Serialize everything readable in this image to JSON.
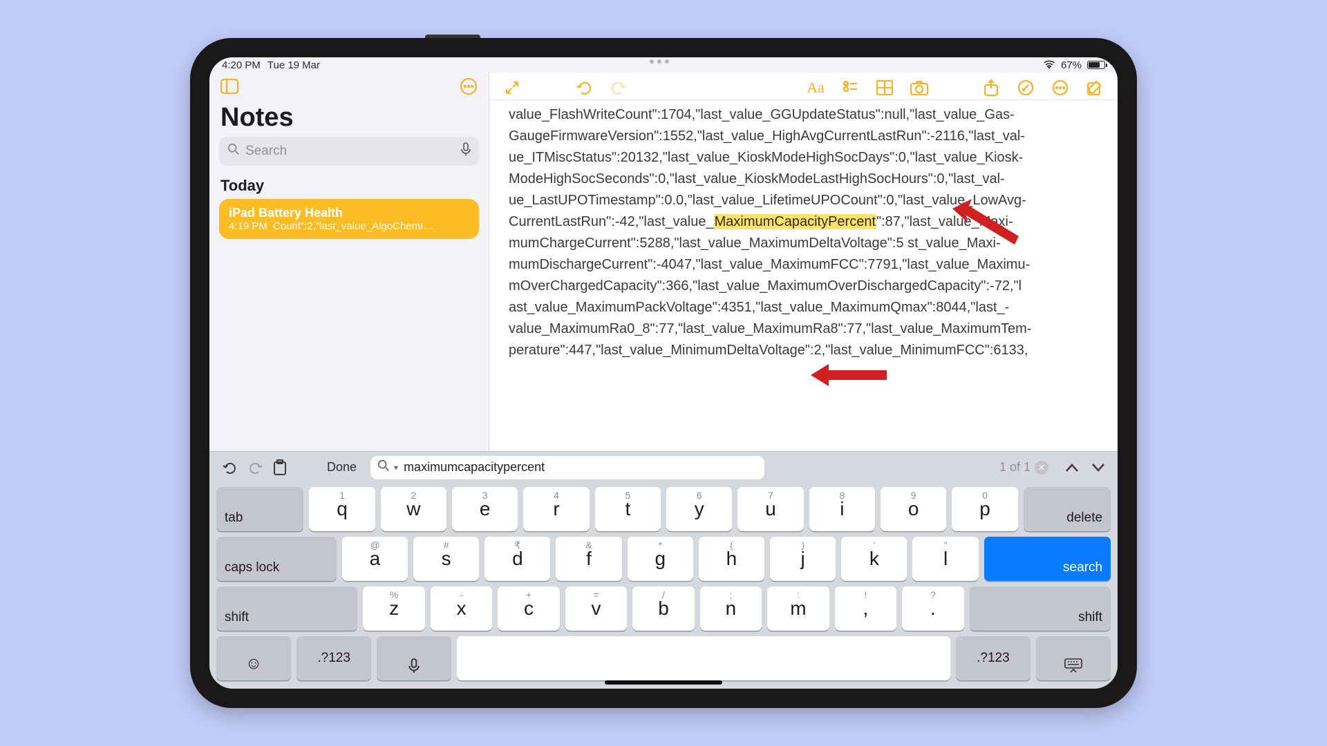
{
  "status": {
    "time": "4:20 PM",
    "date": "Tue 19 Mar",
    "battery_pct": "67%"
  },
  "sidebar": {
    "title": "Notes",
    "search_placeholder": "Search",
    "section": "Today",
    "note": {
      "title": "iPad Battery Health",
      "time": "4:19 PM",
      "preview": "Count\":2,\"last_value_AlgoChemI…"
    }
  },
  "note": {
    "pre_text": "value_FlashWriteCount\":1704,\"last_value_GGUpdateStatus\":null,\"last_value_Gas-GaugeFirmwareVersion\":1552,\"last_value_HighAvgCurrentLastRun\":-2116,\"last_val-ue_ITMiscStatus\":20132,\"last_value_KioskModeHighSocDays\":0,\"last_value_Kiosk-ModeHighSocSeconds\":0,\"last_value_KioskModeLastHighSocHours\":0,\"last_val-ue_LastUPOTimestamp\":0.0,\"last_value_LifetimeUPOCount\":0,\"last_value_LowAvg-CurrentLastRun\":-42,\"last_value_",
    "highlight": "MaximumCapacityPercent",
    "post_text": "\":87,\"last_value_Maxi-mumChargeCurrent\":5288,\"last_value_MaximumDeltaVoltage\":5   st_value_Maxi-mumDischargeCurrent\":-4047,\"last_value_MaximumFCC\":7791,\"last_value_Maximu-mOverChargedCapacity\":366,\"last_value_MaximumOverDischargedCapacity\":-72,\"l ast_value_MaximumPackVoltage\":4351,\"last_value_MaximumQmax\":8044,\"last_-value_MaximumRa0_8\":77,\"last_value_MaximumRa8\":77,\"last_value_MaximumTem-perature\":447,\"last_value_MinimumDeltaVoltage\":2,\"last_value_MinimumFCC\":6133,"
  },
  "findbar": {
    "done_label": "Done",
    "query": "maximumcapacitypercent",
    "match_text": "1 of 1"
  },
  "keyboard": {
    "tab": "tab",
    "delete": "delete",
    "capslock": "caps lock",
    "search": "search",
    "shift": "shift",
    "symbols": ".?123",
    "row1": [
      {
        "main": "q",
        "sub": "1"
      },
      {
        "main": "w",
        "sub": "2"
      },
      {
        "main": "e",
        "sub": "3"
      },
      {
        "main": "r",
        "sub": "4"
      },
      {
        "main": "t",
        "sub": "5"
      },
      {
        "main": "y",
        "sub": "6"
      },
      {
        "main": "u",
        "sub": "7"
      },
      {
        "main": "i",
        "sub": "8"
      },
      {
        "main": "o",
        "sub": "9"
      },
      {
        "main": "p",
        "sub": "0"
      }
    ],
    "row2": [
      {
        "main": "a",
        "sub": "@"
      },
      {
        "main": "s",
        "sub": "#"
      },
      {
        "main": "d",
        "sub": "₹"
      },
      {
        "main": "f",
        "sub": "&"
      },
      {
        "main": "g",
        "sub": "*"
      },
      {
        "main": "h",
        "sub": "("
      },
      {
        "main": "j",
        "sub": ")"
      },
      {
        "main": "k",
        "sub": "'"
      },
      {
        "main": "l",
        "sub": "\""
      }
    ],
    "row3": [
      {
        "main": "z",
        "sub": "%"
      },
      {
        "main": "x",
        "sub": "-"
      },
      {
        "main": "c",
        "sub": "+"
      },
      {
        "main": "v",
        "sub": "="
      },
      {
        "main": "b",
        "sub": "/"
      },
      {
        "main": "n",
        "sub": ";"
      },
      {
        "main": "m",
        "sub": ":"
      },
      {
        "main": ",",
        "sub": "!"
      },
      {
        "main": ".",
        "sub": "?"
      }
    ]
  }
}
